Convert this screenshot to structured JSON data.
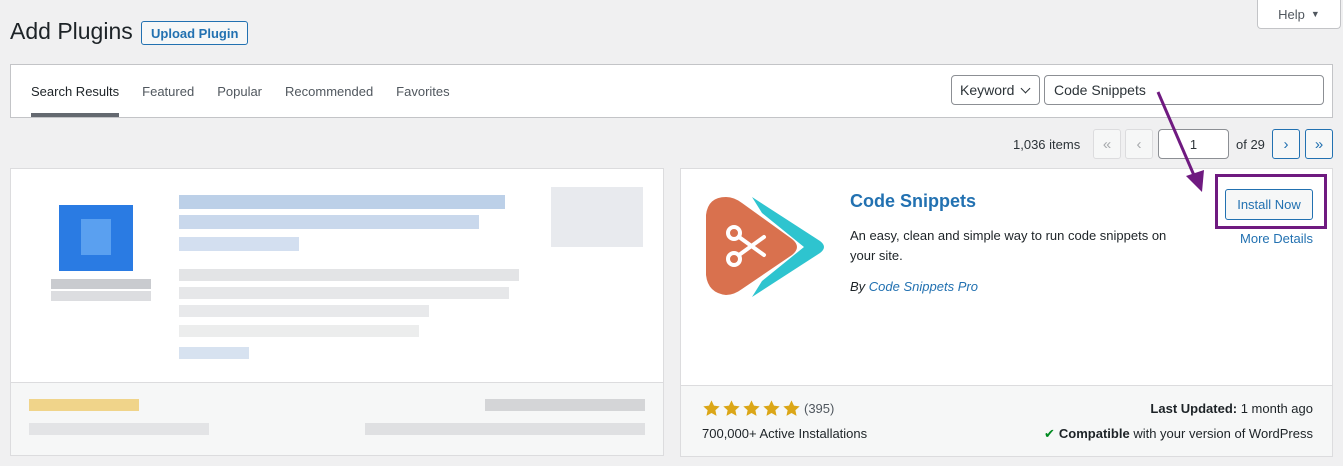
{
  "header": {
    "title": "Add Plugins",
    "upload_label": "Upload Plugin",
    "help_label": "Help"
  },
  "tabs": [
    {
      "label": "Search Results"
    },
    {
      "label": "Featured"
    },
    {
      "label": "Popular"
    },
    {
      "label": "Recommended"
    },
    {
      "label": "Favorites"
    }
  ],
  "search": {
    "type_value": "Keyword",
    "query": "Code Snippets"
  },
  "pagination": {
    "items": "1,036 items",
    "first": "«",
    "prev": "‹",
    "current_page": "1",
    "of_total": "of 29",
    "next": "›",
    "last": "»"
  },
  "plugin": {
    "name": "Code Snippets",
    "description": "An easy, clean and simple way to run code snippets on your site.",
    "by": "By",
    "author": "Code Snippets Pro",
    "install_label": "Install Now",
    "more_details_label": "More Details",
    "rating_stars": 5,
    "rating_count": "(395)",
    "installs": "700,000+ Active Installations",
    "last_updated_label": "Last Updated:",
    "last_updated_value": "1 month ago",
    "compatible_label": "Compatible",
    "compatible_rest": "with your version of WordPress",
    "icon_colors": {
      "orange": "#d9714e",
      "teal": "#2ec4cf"
    }
  },
  "colors": {
    "accent": "#2271b1",
    "highlight": "#6f1a80",
    "star": "#dba617"
  }
}
